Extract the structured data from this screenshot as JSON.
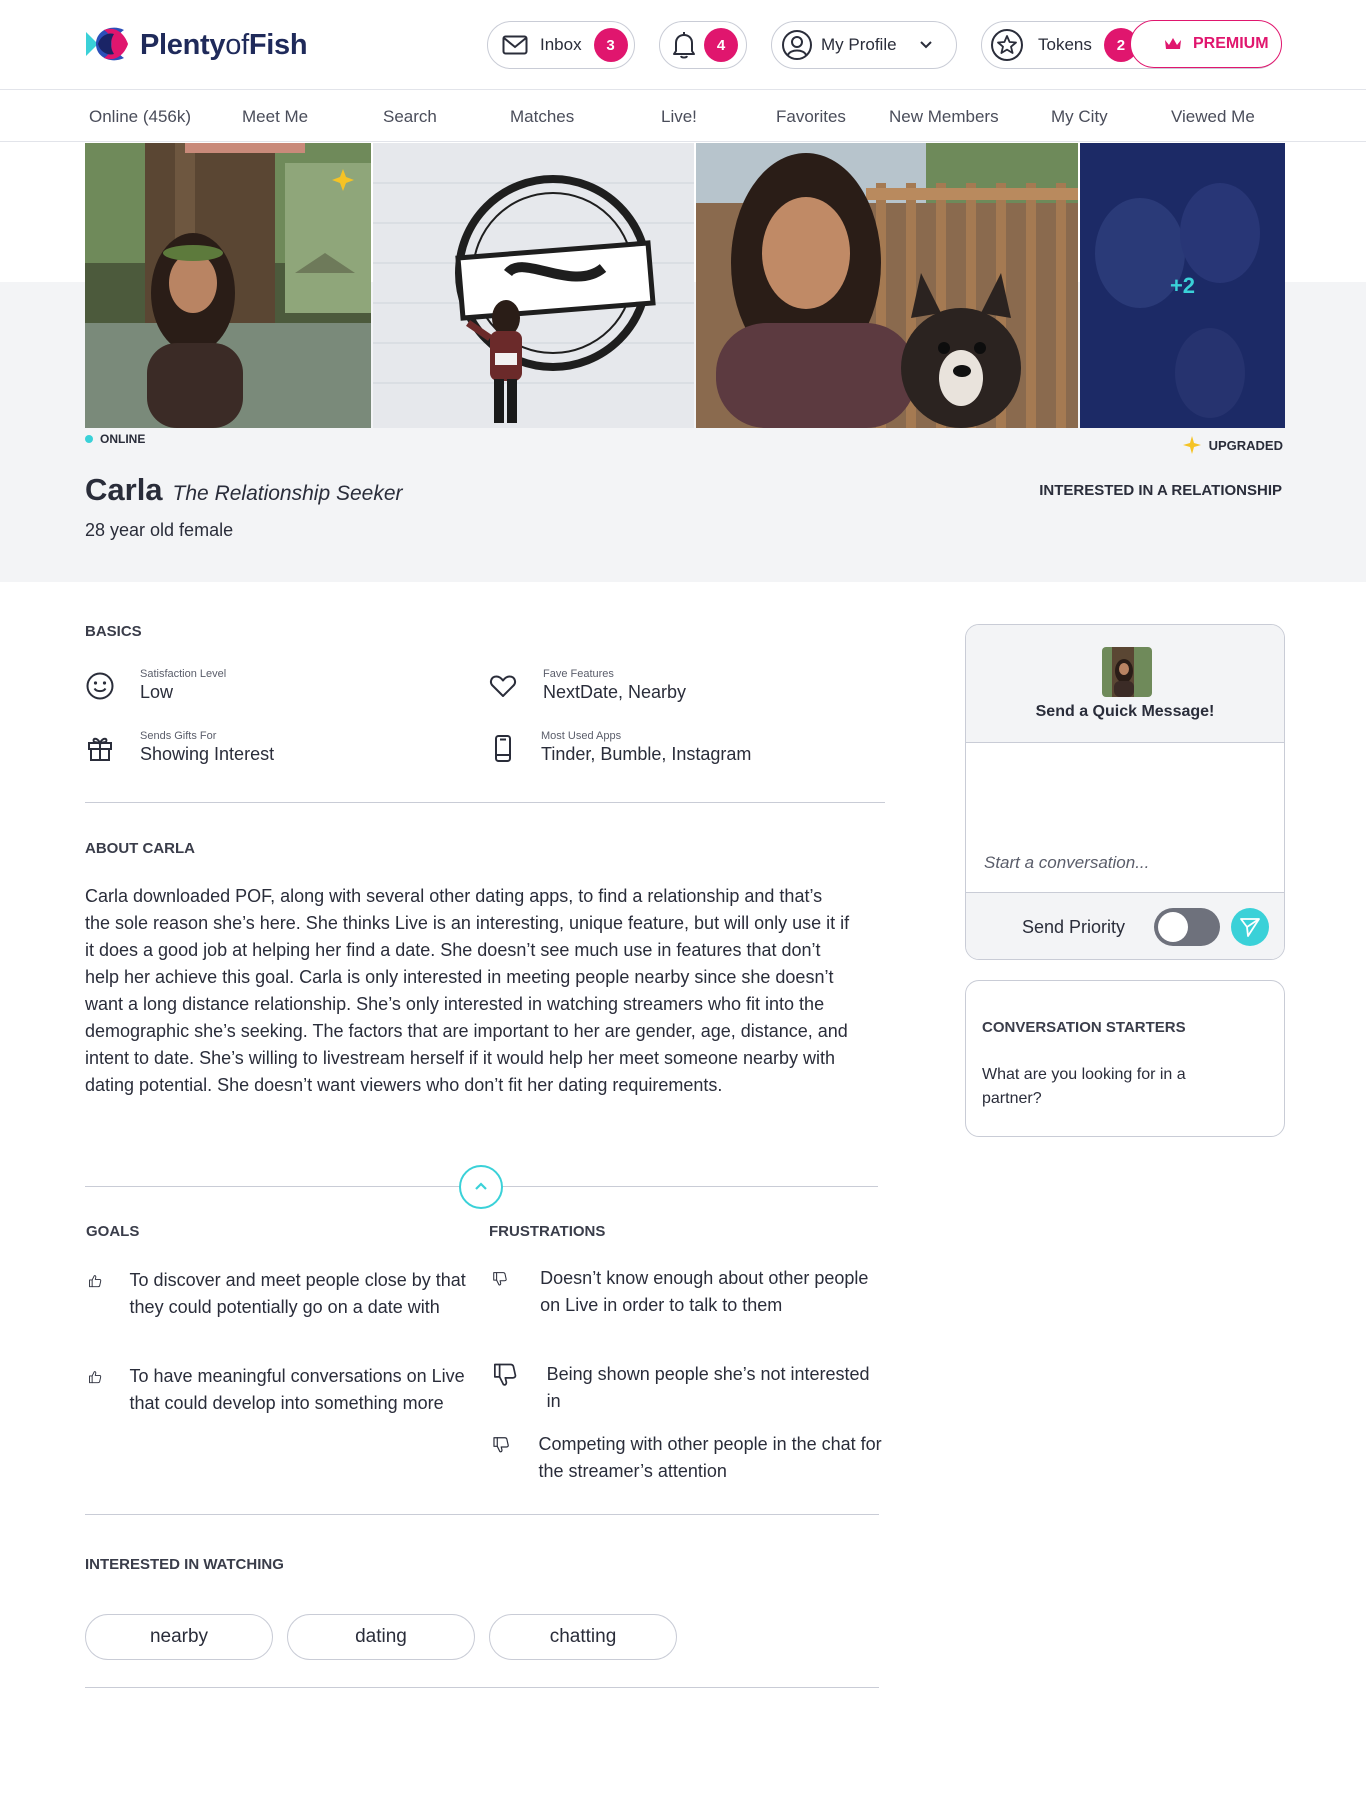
{
  "app": {
    "logo_text_a": "Plenty",
    "logo_text_b": "of",
    "logo_text_c": "Fish"
  },
  "header": {
    "inbox": {
      "label": "Inbox",
      "count": "3"
    },
    "notifications": {
      "count": "4"
    },
    "profile": {
      "label": "My Profile"
    },
    "tokens": {
      "label": "Tokens",
      "count": "2"
    },
    "premium": {
      "label": "PREMIUM"
    }
  },
  "nav": {
    "items": [
      {
        "label": "Online (456k)"
      },
      {
        "label": "Meet Me"
      },
      {
        "label": "Search"
      },
      {
        "label": "Matches"
      },
      {
        "label": "Live!"
      },
      {
        "label": "Favorites"
      },
      {
        "label": "New Members"
      },
      {
        "label": "My City"
      },
      {
        "label": "Viewed Me"
      }
    ]
  },
  "profile": {
    "photos_more": "+2",
    "status": "ONLINE",
    "upgraded": "UPGRADED",
    "name": "Carla",
    "persona": "The Relationship Seeker",
    "age_gender": "28 year old female",
    "intent": "INTERESTED IN A RELATIONSHIP"
  },
  "basics": {
    "title": "BASICS",
    "items": [
      {
        "label": "Satisfaction Level",
        "value": "Low",
        "icon": "smiley-icon"
      },
      {
        "label": "Fave Features",
        "value": "NextDate, Nearby",
        "icon": "heart-icon"
      },
      {
        "label": "Sends Gifts For",
        "value": "Showing Interest",
        "icon": "gift-icon"
      },
      {
        "label": "Most Used Apps",
        "value": "Tinder, Bumble, Instagram",
        "icon": "phone-icon"
      }
    ]
  },
  "about": {
    "title": "ABOUT CARLA",
    "text": "Carla downloaded POF, along with several other dating apps, to find a relationship and that’s the sole reason she’s here. She thinks Live is an interesting, unique feature, but will only use it if it does a good job at helping her find a date. She doesn’t see much use in features that don’t help her achieve this goal. Carla is only interested in meeting people nearby since she doesn’t want a long distance relationship. She’s only interested in watching streamers who fit into the demographic she’s seeking. The factors that are important to her are gender, age, distance, and intent to date. She’s willing to livestream herself if it would help her meet someone nearby with dating potential. She doesn’t want viewers who don’t fit her dating requirements."
  },
  "goals": {
    "title": "GOALS",
    "items": [
      "To discover and meet people close by that they could potentially go on a date with",
      "To have meaningful conversations on Live that could develop into something more"
    ]
  },
  "frustrations": {
    "title": "FRUSTRATIONS",
    "items": [
      "Doesn’t know enough about other people on Live in order to talk to them",
      "Being shown people she’s not interested in",
      "Competing with other people in the chat for the streamer’s attention"
    ]
  },
  "watching": {
    "title": "INTERESTED IN WATCHING",
    "tags": [
      "nearby",
      "dating",
      "chatting"
    ]
  },
  "quick_message": {
    "title": "Send a Quick Message!",
    "placeholder": "Start a conversation...",
    "priority_label": "Send Priority",
    "priority_on": false
  },
  "conversation_starters": {
    "title": "CONVERSATION STARTERS",
    "items": [
      "What are you looking for in a partner?"
    ]
  },
  "colors": {
    "accent_teal": "#3ad1d8",
    "accent_pink": "#e0166e",
    "brand_navy": "#1f2a5a",
    "panel_gray": "#f3f4f6"
  }
}
